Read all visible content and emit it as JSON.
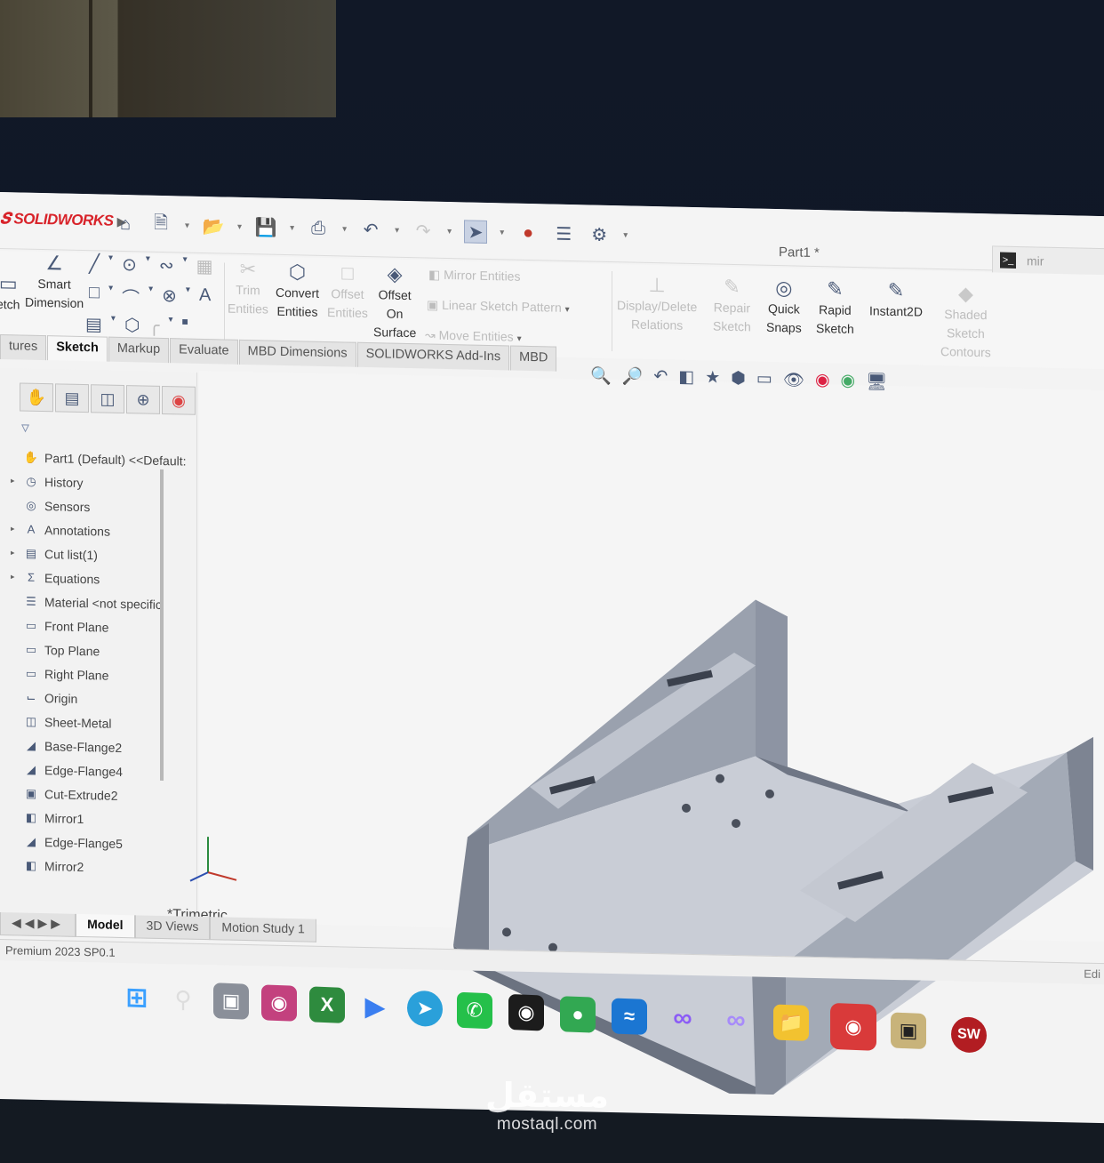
{
  "app": {
    "brand": "SOLIDWORKS",
    "document_title": "Part1 *",
    "search_placeholder": "mir"
  },
  "ribbon": {
    "sketch_label": "etch",
    "smart_dimension": [
      "Smart",
      "Dimension"
    ],
    "trim_entities": [
      "Trim",
      "Entities"
    ],
    "convert_entities": [
      "Convert",
      "Entities"
    ],
    "offset_entities": [
      "Offset",
      "Entities"
    ],
    "offset_on_surface": [
      "Offset",
      "On",
      "Surface"
    ],
    "mirror_entities": "Mirror Entities",
    "linear_sketch_pattern": "Linear Sketch Pattern",
    "move_entities": "Move Entities",
    "display_delete_relations": [
      "Display/Delete",
      "Relations"
    ],
    "repair_sketch": [
      "Repair",
      "Sketch"
    ],
    "quick_snaps": [
      "Quick",
      "Snaps"
    ],
    "rapid_sketch": [
      "Rapid",
      "Sketch"
    ],
    "instant2d": "Instant2D",
    "shaded_sketch_contours": [
      "Shaded",
      "Sketch",
      "Contours"
    ]
  },
  "tabs": [
    "tures",
    "Sketch",
    "Markup",
    "Evaluate",
    "MBD Dimensions",
    "SOLIDWORKS Add-Ins",
    "MBD"
  ],
  "active_tab": "Sketch",
  "feature_tree": [
    {
      "label": "Part1 (Default) <<Default:",
      "icon": "part-icon",
      "expand": false
    },
    {
      "label": "History",
      "icon": "history-icon",
      "expand": true
    },
    {
      "label": "Sensors",
      "icon": "sensor-icon",
      "expand": false
    },
    {
      "label": "Annotations",
      "icon": "annotation-icon",
      "expand": true
    },
    {
      "label": "Cut list(1)",
      "icon": "cutlist-icon",
      "expand": true
    },
    {
      "label": "Equations",
      "icon": "equation-icon",
      "expand": true
    },
    {
      "label": "Material <not specific",
      "icon": "material-icon",
      "expand": false
    },
    {
      "label": "Front Plane",
      "icon": "plane-icon",
      "expand": false
    },
    {
      "label": "Top Plane",
      "icon": "plane-icon",
      "expand": false
    },
    {
      "label": "Right Plane",
      "icon": "plane-icon",
      "expand": false
    },
    {
      "label": "Origin",
      "icon": "origin-icon",
      "expand": false
    },
    {
      "label": "Sheet-Metal",
      "icon": "sheetmetal-icon",
      "expand": false
    },
    {
      "label": "Base-Flange2",
      "icon": "flange-icon",
      "expand": false
    },
    {
      "label": "Edge-Flange4",
      "icon": "flange-icon",
      "expand": false
    },
    {
      "label": "Cut-Extrude2",
      "icon": "cut-icon",
      "expand": false
    },
    {
      "label": "Mirror1",
      "icon": "mirror-icon",
      "expand": false
    },
    {
      "label": "Edge-Flange5",
      "icon": "flange-icon",
      "expand": false
    },
    {
      "label": "Mirror2",
      "icon": "mirror-icon",
      "expand": false
    }
  ],
  "viewport": {
    "view_orientation": "*Trimetric"
  },
  "bottom_tabs": [
    "Model",
    "3D Views",
    "Motion Study 1"
  ],
  "active_bottom_tab": "Model",
  "status_bar": {
    "version": "Premium 2023 SP0.1",
    "right": "Edi"
  },
  "taskbar_apps": [
    "start-icon",
    "search-icon",
    "task-view-icon",
    "app-icon",
    "xbox-icon",
    "media-icon",
    "telegram-icon",
    "whatsapp-icon",
    "qq-icon",
    "wechat-icon",
    "database-icon",
    "visual-studio-icon",
    "visual-studio-icon",
    "file-explorer-icon",
    "edge-icon",
    "app-icon",
    "solidworks-icon"
  ],
  "watermark": {
    "arabic": "مستقل",
    "latin": "mostaql.com"
  },
  "colors": {
    "brand_red": "#d8232a",
    "model_gray": "#b8bdc8",
    "ui_blue": "#4a5a78"
  }
}
